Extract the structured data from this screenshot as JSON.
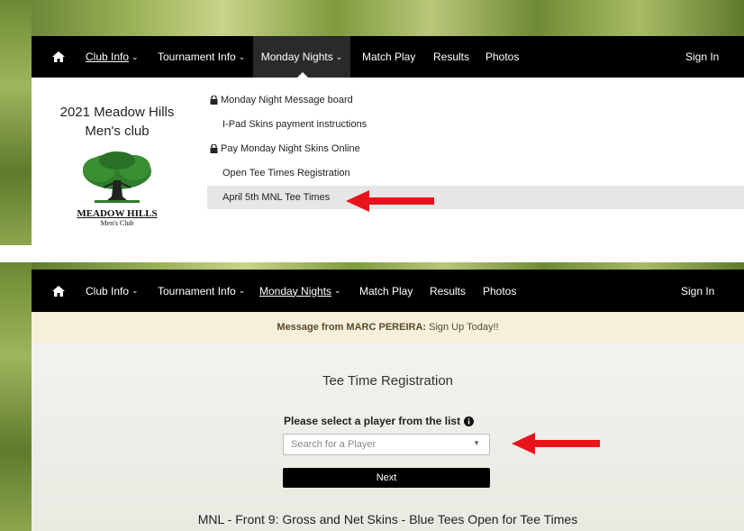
{
  "top": {
    "nav": {
      "club_info": "Club Info",
      "tournament_info": "Tournament Info",
      "monday_nights": "Monday Nights",
      "match_play": "Match Play",
      "results": "Results",
      "photos": "Photos",
      "sign_in": "Sign In"
    },
    "club_name_line1": "2021 Meadow Hills",
    "club_name_line2": "Men's club",
    "logo_text_main": "MEADOW HILLS",
    "logo_text_sub": "Men's Club",
    "menu_items": [
      {
        "label": "Monday Night Message board",
        "locked": true
      },
      {
        "label": "I-Pad Skins payment instructions",
        "locked": false
      },
      {
        "label": "Pay Monday Night Skins Online",
        "locked": true
      },
      {
        "label": "Open Tee Times Registration",
        "locked": false
      },
      {
        "label": "April 5th MNL Tee Times",
        "locked": false
      }
    ]
  },
  "bottom": {
    "nav": {
      "club_info": "Club Info",
      "tournament_info": "Tournament Info",
      "monday_nights": "Monday Nights",
      "match_play": "Match Play",
      "results": "Results",
      "photos": "Photos",
      "sign_in": "Sign In"
    },
    "message_prefix": "Message from MARC PEREIRA:",
    "message_text": "Sign Up Today!!",
    "registration_title": "Tee Time Registration",
    "select_label": "Please select a player from the list",
    "search_placeholder": "Search for a Player",
    "next_label": "Next",
    "event_title": "MNL - Front 9: Gross and Net Skins - Blue Tees Open for Tee Times"
  },
  "colors": {
    "arrow": "#e8141b",
    "highlight_row": "#e6e6e6",
    "message_bar": "#f6efd9",
    "tree_green": "#2f7d2a"
  }
}
